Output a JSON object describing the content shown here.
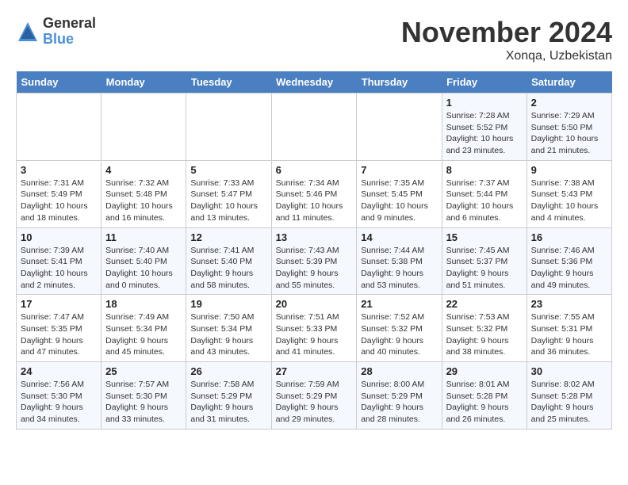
{
  "logo": {
    "general": "General",
    "blue": "Blue"
  },
  "title": "November 2024",
  "location": "Xonqa, Uzbekistan",
  "weekdays": [
    "Sunday",
    "Monday",
    "Tuesday",
    "Wednesday",
    "Thursday",
    "Friday",
    "Saturday"
  ],
  "weeks": [
    [
      {
        "day": "",
        "info": ""
      },
      {
        "day": "",
        "info": ""
      },
      {
        "day": "",
        "info": ""
      },
      {
        "day": "",
        "info": ""
      },
      {
        "day": "",
        "info": ""
      },
      {
        "day": "1",
        "info": "Sunrise: 7:28 AM\nSunset: 5:52 PM\nDaylight: 10 hours\nand 23 minutes."
      },
      {
        "day": "2",
        "info": "Sunrise: 7:29 AM\nSunset: 5:50 PM\nDaylight: 10 hours\nand 21 minutes."
      }
    ],
    [
      {
        "day": "3",
        "info": "Sunrise: 7:31 AM\nSunset: 5:49 PM\nDaylight: 10 hours\nand 18 minutes."
      },
      {
        "day": "4",
        "info": "Sunrise: 7:32 AM\nSunset: 5:48 PM\nDaylight: 10 hours\nand 16 minutes."
      },
      {
        "day": "5",
        "info": "Sunrise: 7:33 AM\nSunset: 5:47 PM\nDaylight: 10 hours\nand 13 minutes."
      },
      {
        "day": "6",
        "info": "Sunrise: 7:34 AM\nSunset: 5:46 PM\nDaylight: 10 hours\nand 11 minutes."
      },
      {
        "day": "7",
        "info": "Sunrise: 7:35 AM\nSunset: 5:45 PM\nDaylight: 10 hours\nand 9 minutes."
      },
      {
        "day": "8",
        "info": "Sunrise: 7:37 AM\nSunset: 5:44 PM\nDaylight: 10 hours\nand 6 minutes."
      },
      {
        "day": "9",
        "info": "Sunrise: 7:38 AM\nSunset: 5:43 PM\nDaylight: 10 hours\nand 4 minutes."
      }
    ],
    [
      {
        "day": "10",
        "info": "Sunrise: 7:39 AM\nSunset: 5:41 PM\nDaylight: 10 hours\nand 2 minutes."
      },
      {
        "day": "11",
        "info": "Sunrise: 7:40 AM\nSunset: 5:40 PM\nDaylight: 10 hours\nand 0 minutes."
      },
      {
        "day": "12",
        "info": "Sunrise: 7:41 AM\nSunset: 5:40 PM\nDaylight: 9 hours\nand 58 minutes."
      },
      {
        "day": "13",
        "info": "Sunrise: 7:43 AM\nSunset: 5:39 PM\nDaylight: 9 hours\nand 55 minutes."
      },
      {
        "day": "14",
        "info": "Sunrise: 7:44 AM\nSunset: 5:38 PM\nDaylight: 9 hours\nand 53 minutes."
      },
      {
        "day": "15",
        "info": "Sunrise: 7:45 AM\nSunset: 5:37 PM\nDaylight: 9 hours\nand 51 minutes."
      },
      {
        "day": "16",
        "info": "Sunrise: 7:46 AM\nSunset: 5:36 PM\nDaylight: 9 hours\nand 49 minutes."
      }
    ],
    [
      {
        "day": "17",
        "info": "Sunrise: 7:47 AM\nSunset: 5:35 PM\nDaylight: 9 hours\nand 47 minutes."
      },
      {
        "day": "18",
        "info": "Sunrise: 7:49 AM\nSunset: 5:34 PM\nDaylight: 9 hours\nand 45 minutes."
      },
      {
        "day": "19",
        "info": "Sunrise: 7:50 AM\nSunset: 5:34 PM\nDaylight: 9 hours\nand 43 minutes."
      },
      {
        "day": "20",
        "info": "Sunrise: 7:51 AM\nSunset: 5:33 PM\nDaylight: 9 hours\nand 41 minutes."
      },
      {
        "day": "21",
        "info": "Sunrise: 7:52 AM\nSunset: 5:32 PM\nDaylight: 9 hours\nand 40 minutes."
      },
      {
        "day": "22",
        "info": "Sunrise: 7:53 AM\nSunset: 5:32 PM\nDaylight: 9 hours\nand 38 minutes."
      },
      {
        "day": "23",
        "info": "Sunrise: 7:55 AM\nSunset: 5:31 PM\nDaylight: 9 hours\nand 36 minutes."
      }
    ],
    [
      {
        "day": "24",
        "info": "Sunrise: 7:56 AM\nSunset: 5:30 PM\nDaylight: 9 hours\nand 34 minutes."
      },
      {
        "day": "25",
        "info": "Sunrise: 7:57 AM\nSunset: 5:30 PM\nDaylight: 9 hours\nand 33 minutes."
      },
      {
        "day": "26",
        "info": "Sunrise: 7:58 AM\nSunset: 5:29 PM\nDaylight: 9 hours\nand 31 minutes."
      },
      {
        "day": "27",
        "info": "Sunrise: 7:59 AM\nSunset: 5:29 PM\nDaylight: 9 hours\nand 29 minutes."
      },
      {
        "day": "28",
        "info": "Sunrise: 8:00 AM\nSunset: 5:29 PM\nDaylight: 9 hours\nand 28 minutes."
      },
      {
        "day": "29",
        "info": "Sunrise: 8:01 AM\nSunset: 5:28 PM\nDaylight: 9 hours\nand 26 minutes."
      },
      {
        "day": "30",
        "info": "Sunrise: 8:02 AM\nSunset: 5:28 PM\nDaylight: 9 hours\nand 25 minutes."
      }
    ]
  ]
}
